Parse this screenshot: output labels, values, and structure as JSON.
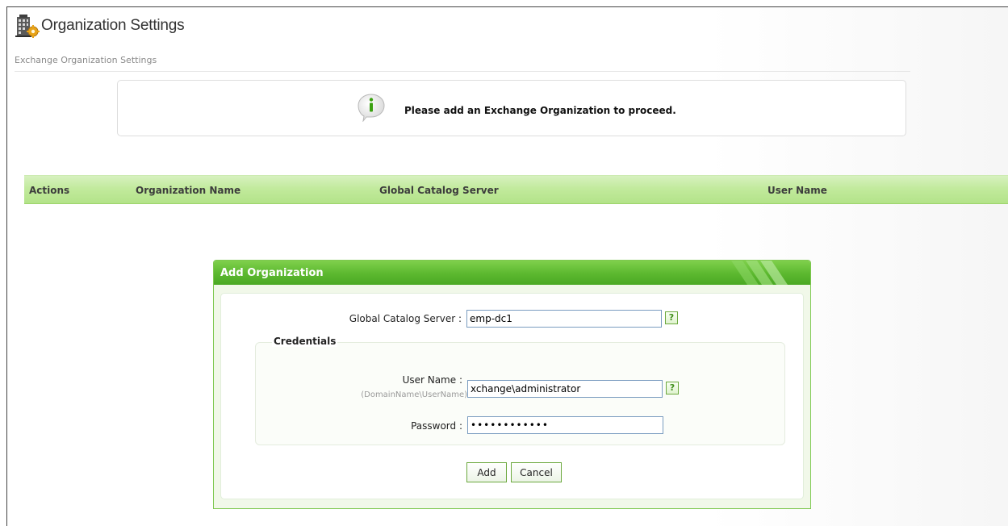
{
  "header": {
    "title": "Organization Settings",
    "subtitle": "Exchange Organization Settings",
    "icon": "building-gear-icon"
  },
  "notice": {
    "icon": "info-icon",
    "text": "Please add an Exchange Organization to proceed."
  },
  "grid": {
    "columns": [
      "Actions",
      "Organization Name",
      "Global Catalog Server",
      "User Name"
    ]
  },
  "dialog": {
    "title": "Add Organization",
    "global_catalog": {
      "label": "Global Catalog Server :",
      "value": "emp-dc1",
      "help": "?"
    },
    "credentials": {
      "legend": "Credentials",
      "username": {
        "label": "User Name :",
        "hint": "(DomainName\\UserName)",
        "value": "xchange\\administrator",
        "help": "?"
      },
      "password": {
        "label": "Password :",
        "value": "••••••••••••"
      }
    },
    "buttons": {
      "add": "Add",
      "cancel": "Cancel"
    }
  },
  "colors": {
    "accent_green": "#5cb82f",
    "grid_header_green": "#c2ea9d",
    "input_border": "#7a9cc0"
  }
}
